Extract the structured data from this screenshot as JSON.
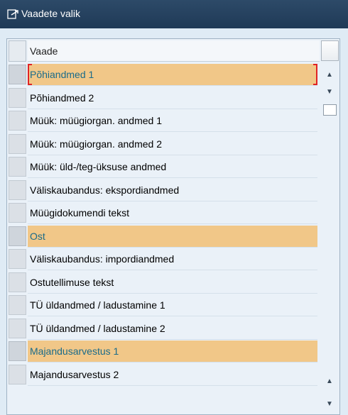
{
  "window": {
    "title": "Vaadete valik",
    "icon": "select-dialog-icon"
  },
  "table": {
    "column_header": "Vaade",
    "rows": [
      {
        "label": "Põhiandmed 1",
        "selected": true,
        "focused": true
      },
      {
        "label": "Põhiandmed 2",
        "selected": false
      },
      {
        "label": "Müük: müügiorgan. andmed 1",
        "selected": false
      },
      {
        "label": "Müük: müügiorgan. andmed 2",
        "selected": false
      },
      {
        "label": "Müük: üld-/teg-üksuse andmed",
        "selected": false
      },
      {
        "label": "Väliskaubandus: ekspordiandmed",
        "selected": false
      },
      {
        "label": "Müügidokumendi tekst",
        "selected": false
      },
      {
        "label": "Ost",
        "selected": true
      },
      {
        "label": "Väliskaubandus: impordiandmed",
        "selected": false
      },
      {
        "label": "Ostutellimuse tekst",
        "selected": false
      },
      {
        "label": "TÜ üldandmed / ladustamine 1",
        "selected": false
      },
      {
        "label": "TÜ üldandmed / ladustamine 2",
        "selected": false
      },
      {
        "label": "Majandusarvestus 1",
        "selected": true
      },
      {
        "label": "Majandusarvestus 2",
        "selected": false
      }
    ]
  },
  "scrollbar": {
    "up_glyph": "▲",
    "down_glyph": "▼"
  },
  "colors": {
    "title_bar": "#1f3a57",
    "selected_row": "#f1c788",
    "selected_text": "#1a6b8a",
    "focus_marker": "#e02424",
    "background": "#dfebf5"
  }
}
